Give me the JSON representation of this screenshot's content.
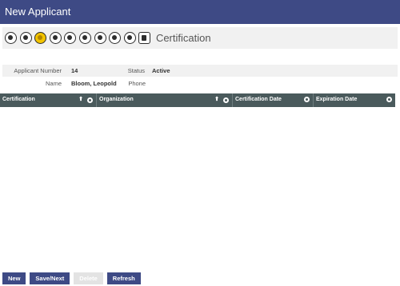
{
  "window": {
    "title": "New Applicant"
  },
  "toolbar": {
    "section_title": "Certification",
    "icons": [
      "applicant-icon",
      "radio-dot-icon",
      "person-gold-icon",
      "tag-icon",
      "globe-icon",
      "printer-icon",
      "building-icon",
      "hand-icon",
      "search-person-icon",
      "document-icon"
    ]
  },
  "applicant": {
    "number_label": "Applicant Number",
    "number_value": "14",
    "status_label": "Status",
    "status_value": "Active",
    "name_label": "Name",
    "name_value": "Bloom, Leopold",
    "phone_label": "Phone",
    "phone_value": ""
  },
  "grid": {
    "columns": [
      {
        "label": "Certification",
        "sortable": true
      },
      {
        "label": "Organization",
        "sortable": true
      },
      {
        "label": "Certification Date",
        "sortable": false
      },
      {
        "label": "Expiration Date",
        "sortable": false
      }
    ],
    "sort_arrow": "⬆",
    "rows": []
  },
  "buttons": {
    "new": "New",
    "save_next": "Save/Next",
    "delete": "Delete",
    "refresh": "Refresh"
  },
  "colors": {
    "title_bar": "#3e4a85",
    "grid_header": "#4a5a5c",
    "highlight_icon": "#f3c400"
  }
}
